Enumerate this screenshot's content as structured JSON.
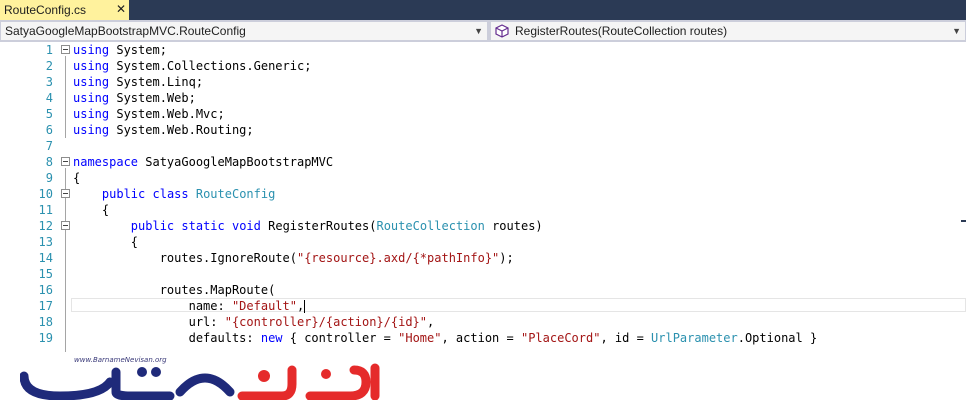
{
  "tab": {
    "title": "RouteConfig.cs",
    "close": "✕"
  },
  "navbar": {
    "project_scope": "SatyaGoogleMapBootstrapMVC.RouteConfig",
    "member_scope": "RegisterRoutes(RouteCollection routes)"
  },
  "editor": {
    "lines": [
      {
        "n": "1"
      },
      {
        "n": "2"
      },
      {
        "n": "3"
      },
      {
        "n": "4"
      },
      {
        "n": "5"
      },
      {
        "n": "6"
      },
      {
        "n": "7"
      },
      {
        "n": "8"
      },
      {
        "n": "9"
      },
      {
        "n": "10"
      },
      {
        "n": "11"
      },
      {
        "n": "12"
      },
      {
        "n": "13"
      },
      {
        "n": "14"
      },
      {
        "n": "15"
      },
      {
        "n": "16"
      },
      {
        "n": "17"
      },
      {
        "n": "18"
      },
      {
        "n": "19"
      }
    ],
    "tokens": {
      "using": "using",
      "ns1": " System;",
      "ns2": " System.Collections.Generic;",
      "ns3": " System.Linq;",
      "ns4": " System.Web;",
      "ns5": " System.Web.Mvc;",
      "ns6": " System.Web.Routing;",
      "namespace": "namespace",
      "ns_name": " SatyaGoogleMapBootstrapMVC",
      "open_brace": "{",
      "public": "public",
      "class": "class",
      "class_name": "RouteConfig",
      "static": "static",
      "void": "void",
      "method": " RegisterRoutes(",
      "param_type": "RouteCollection",
      "param": " routes)",
      "ignore": "routes.IgnoreRoute(",
      "ignore_str": "\"{resource}.axd/{*pathInfo}\"",
      "ignore_end": ");",
      "maproute": "routes.MapRoute(",
      "name_key": "name: ",
      "name_val": "\"Default\"",
      "comma": ",",
      "url_key": "url: ",
      "url_val": "\"{controller}/{action}/{id}\"",
      "defaults_key": "defaults: ",
      "new": "new",
      "defaults_mid1": " { controller = ",
      "home": "\"Home\"",
      "defaults_mid2": ", action = ",
      "placecord": "\"PlaceCord\"",
      "defaults_mid3": ", id = ",
      "urlparam": "UrlParameter",
      "optional": ".Optional }"
    }
  },
  "watermark": {
    "url": "www.BarnameNevisan.org",
    "logo": "برنامه نویسان"
  },
  "colors": {
    "keyword": "#0000ff",
    "type": "#2b91af",
    "string": "#a31515",
    "line_number": "#2b91af",
    "tab_active": "#fff29d",
    "tabstrip": "#2b3a55",
    "logo_red": "#e52b2b",
    "logo_blue": "#1f2a7a"
  },
  "icons": {
    "member": "cube-icon",
    "fold": "collapse-icon",
    "dropdown": "chevron-down-icon"
  }
}
